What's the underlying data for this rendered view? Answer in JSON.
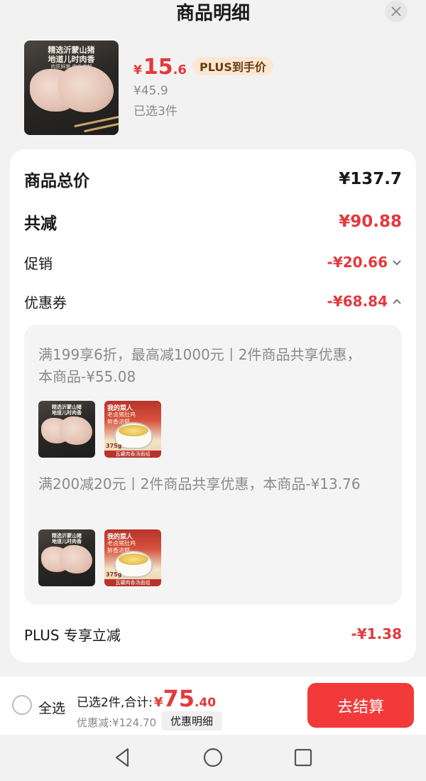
{
  "header": {
    "title": "商品明细",
    "close_icon": "close-icon"
  },
  "product": {
    "thumb_caption_1": "精选沂蒙山猪",
    "thumb_caption_2": "地道儿时肉香",
    "thumb_caption_3": "肉质鲜嫩 肉香浓郁",
    "price_symbol": "¥",
    "price_int": "15",
    "price_dec": ".6",
    "plus_tag": "PLUS到手价",
    "orig_price": "¥45.9",
    "selected": "已选3件"
  },
  "summary": {
    "total_label": "商品总价",
    "total_value": "¥137.7",
    "reduce_label": "共减",
    "reduce_value": "¥90.88",
    "promo_label": "促销",
    "promo_value": "-¥20.66",
    "coupon_label": "优惠券",
    "coupon_value": "-¥68.84",
    "plus_label": "PLUS 专享立减",
    "plus_value": "-¥1.38"
  },
  "coupons": [
    {
      "text": "满199享6折，最高减1000元丨2件商品共享优惠，本商品-¥55.08"
    },
    {
      "text": "满200减20元丨2件商品共享优惠，本商品-¥13.76"
    }
  ],
  "thumb2": {
    "brand": "我的菜人",
    "line1": "老卤猪肚鸡",
    "line2": "鲜香浓郁",
    "weight": "375g",
    "bottom": "瓦罐肉香汤面组"
  },
  "footer": {
    "select_all": "全选",
    "sum_label": "已选2件,合计:",
    "sum_symbol": "¥",
    "sum_int": "75",
    "sum_dec": ".40",
    "discount": "优惠减:¥124.70",
    "detail_button": "优惠明细",
    "checkout_button": "去结算"
  },
  "colors": {
    "accent": "#e4393c",
    "checkout": "#f23a3a",
    "plus_tag_bg": "#fbe7d2"
  }
}
